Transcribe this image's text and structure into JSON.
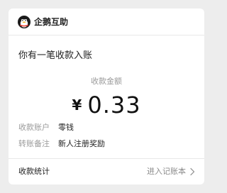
{
  "header": {
    "app_name": "企鹅互助"
  },
  "message": {
    "title": "你有一笔收款入账",
    "amount_caption": "收款金额",
    "currency_symbol": "¥",
    "amount": "0.33"
  },
  "details": [
    {
      "label": "收款账户",
      "value": "零钱"
    },
    {
      "label": "转账备注",
      "value": "新人注册奖励"
    }
  ],
  "footer": {
    "left_label": "收款统计",
    "right_label": "进入记账本"
  },
  "colors": {
    "background": "#ededed",
    "card": "#ffffff",
    "text_primary": "#222222",
    "text_secondary": "#9a9a9a"
  },
  "icons": {
    "logo": "penguin-icon",
    "footer_arrow": "chevron-right-icon"
  }
}
